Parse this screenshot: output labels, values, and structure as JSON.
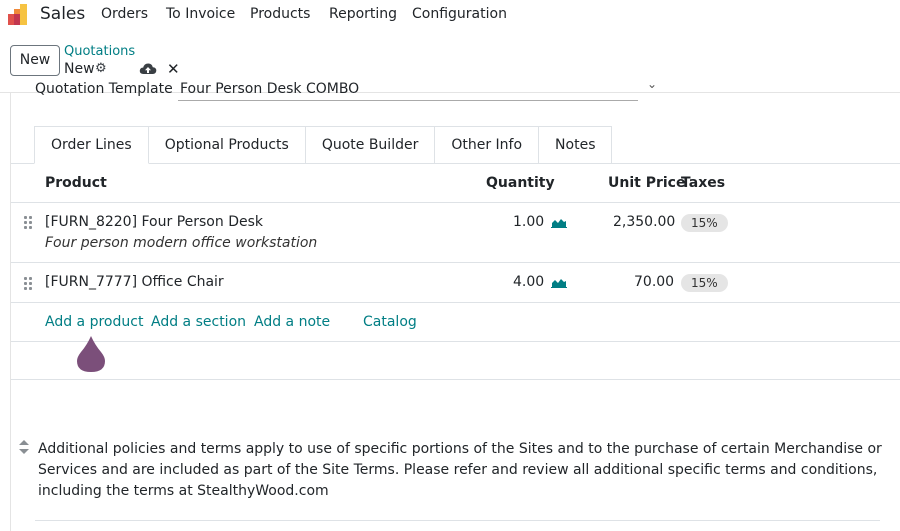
{
  "nav": {
    "app_name": "Sales",
    "items": [
      "Orders",
      "To Invoice",
      "Products",
      "Reporting",
      "Configuration"
    ]
  },
  "control": {
    "new_button": "New",
    "breadcrumb": "Quotations",
    "record_name": "New"
  },
  "form": {
    "template_label": "Quotation Template",
    "template_value": "Four Person Desk COMBO"
  },
  "tabs": [
    "Order Lines",
    "Optional Products",
    "Quote Builder",
    "Other Info",
    "Notes"
  ],
  "columns": {
    "product": "Product",
    "quantity": "Quantity",
    "unit_price": "Unit Price",
    "taxes": "Taxes"
  },
  "lines": [
    {
      "product": "[FURN_8220] Four Person Desk",
      "description": "Four person modern office workstation",
      "quantity": "1.00",
      "unit_price": "2,350.00",
      "tax": "15%"
    },
    {
      "product": "[FURN_7777] Office Chair",
      "quantity": "4.00",
      "unit_price": "70.00",
      "tax": "15%"
    }
  ],
  "actions": {
    "add_product": "Add a product",
    "add_section": "Add a section",
    "add_note": "Add a note",
    "catalog": "Catalog"
  },
  "terms": "Additional policies and terms apply to use of specific portions of the Sites and to the purchase of certain Merchandise or Services and are included as part of the Site Terms. Please refer and review all additional specific terms and conditions, including the terms at StealthyWood.com",
  "icons": {
    "gear": "gear-icon",
    "save": "cloud-upload-icon",
    "discard": "close-icon",
    "forecast": "area-chart-icon",
    "drag": "drag-handle-icon"
  },
  "colors": {
    "accent": "#017e84",
    "marker": "#7b4f7a",
    "badge_bg": "#e5e5e5"
  }
}
